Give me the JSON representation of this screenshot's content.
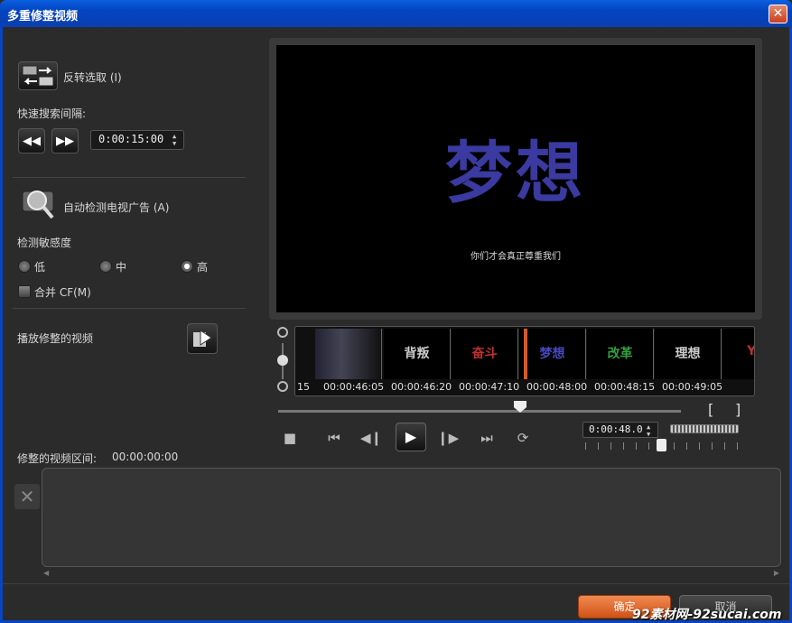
{
  "window": {
    "title": "多重修整视频",
    "close_glyph": "✕"
  },
  "left": {
    "invert_label": "反转选取 (I)",
    "quick_search_label": "快速搜索间隔:",
    "interval_value": "0:00:15:00",
    "auto_detect_label": "自动检测电视广告 (A)",
    "sensitivity_label": "检测敏感度",
    "sensitivity_options": [
      "低",
      "中",
      "高"
    ],
    "sensitivity_selected": "高",
    "merge_label": "合并 CF(M)",
    "play_trimmed_label": "播放修整的视频",
    "trimmed_interval_label": "修整的视频区间:",
    "trimmed_interval_value": "00:00:00:00"
  },
  "preview": {
    "title_text": "梦想",
    "subtitle_text": "你们才会真正尊重我们"
  },
  "timeline": {
    "thumbnails": [
      {
        "text": "",
        "color": "#888888"
      },
      {
        "text": "背叛",
        "color": "#cccccc"
      },
      {
        "text": "奋斗",
        "color": "#c03030"
      },
      {
        "text": "梦想",
        "color": "#4040b0"
      },
      {
        "text": "改革",
        "color": "#30a040"
      },
      {
        "text": "理想",
        "color": "#cccccc"
      },
      {
        "text": "YE",
        "color": "#c03030"
      }
    ],
    "timecodes": [
      "15",
      "00:00:46:05",
      "00:00:46:20",
      "00:00:47:10",
      "00:00:48:00",
      "00:00:48:15",
      "00:00:49:05"
    ]
  },
  "transport": {
    "current_time": "0:00:48.0",
    "mark_in": "[",
    "mark_out": "]"
  },
  "footer": {
    "ok_label": "确定",
    "cancel_label": "取消",
    "watermark": "92素材网-92sucai.com"
  }
}
